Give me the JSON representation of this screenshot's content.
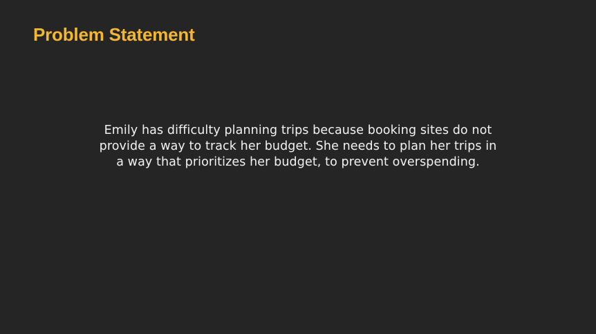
{
  "slide": {
    "title": "Problem Statement",
    "body": "Emily has difficulty planning trips because booking sites do not provide a way to track her budget. She needs to plan her trips in a way that prioritizes her budget, to prevent overspending."
  },
  "colors": {
    "background": "#252525",
    "title": "#f4b731",
    "body_text": "#f2f2f2"
  }
}
